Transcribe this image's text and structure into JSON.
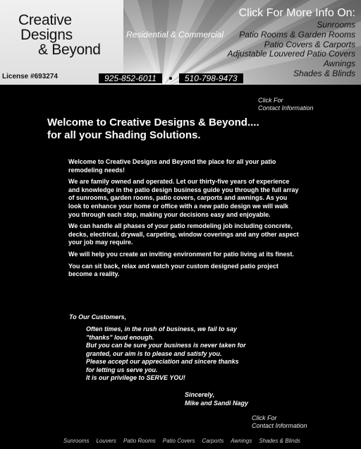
{
  "header": {
    "logo_line1": "Creative",
    "logo_line2": "Designs",
    "logo_line3": "& Beyond",
    "license": "License #693274",
    "tagline": "Residential & Commercial",
    "more_info_title": "Click For More Info On:",
    "services": [
      "Sunrooms",
      "Patio Rooms & Garden Rooms",
      "Patio Covers & Carports",
      "Adjustable Louvered Patio Covers",
      "Awnings",
      "Shades & Blinds"
    ],
    "phone1": "925-852-6011",
    "phone2": "510-798-9473"
  },
  "contact_link_top": {
    "line1": "Click For",
    "line2": "Contact Information"
  },
  "main": {
    "heading_line1": "Welcome to Creative Designs & Beyond....",
    "heading_line2": "for all your Shading Solutions.",
    "paragraphs": [
      "Welcome to Creative Designs and Beyond the place for all your patio remodeling needs!",
      "We are family owned and operated. Let our thirty-five years of experience and knowledge in the patio design business guide you through the full array of sunrooms, garden rooms, patio covers, carports and awnings. As you look to enhance your home or office with a new patio design we will walk you through each step, making your decisions easy and enjoyable.",
      "We can handle all phases of your patio remodeling job including concrete, decks, electrical, drywall, carpeting, window coverings and any other aspect your job may require.",
      "We will help you create an inviting environment for patio living at its finest.",
      "You can sit back, relax and watch your custom designed patio project become a reality."
    ],
    "to_customers": "To Our Customers,",
    "poem": [
      "Often times, in the rush of business, we fail to say",
      "\"thanks\" loud enough.",
      "But you can be sure your business is never taken for",
      "granted, our aim is to please and satisfy you.",
      "Please accept our appreciation and sincere thanks",
      "for letting us serve you.",
      "It is our privilege to SERVE YOU!"
    ],
    "signoff": "Sincerely,",
    "signature": "Mike and Sandi Nagy"
  },
  "contact_link_bottom": {
    "line1": "Click For",
    "line2": "Contact Information"
  },
  "footer_nav": [
    "Sunrooms",
    "Louvers",
    "Patio Rooms",
    "Patio Covers",
    "Carports",
    "Awnings",
    "Shades & Blinds"
  ]
}
